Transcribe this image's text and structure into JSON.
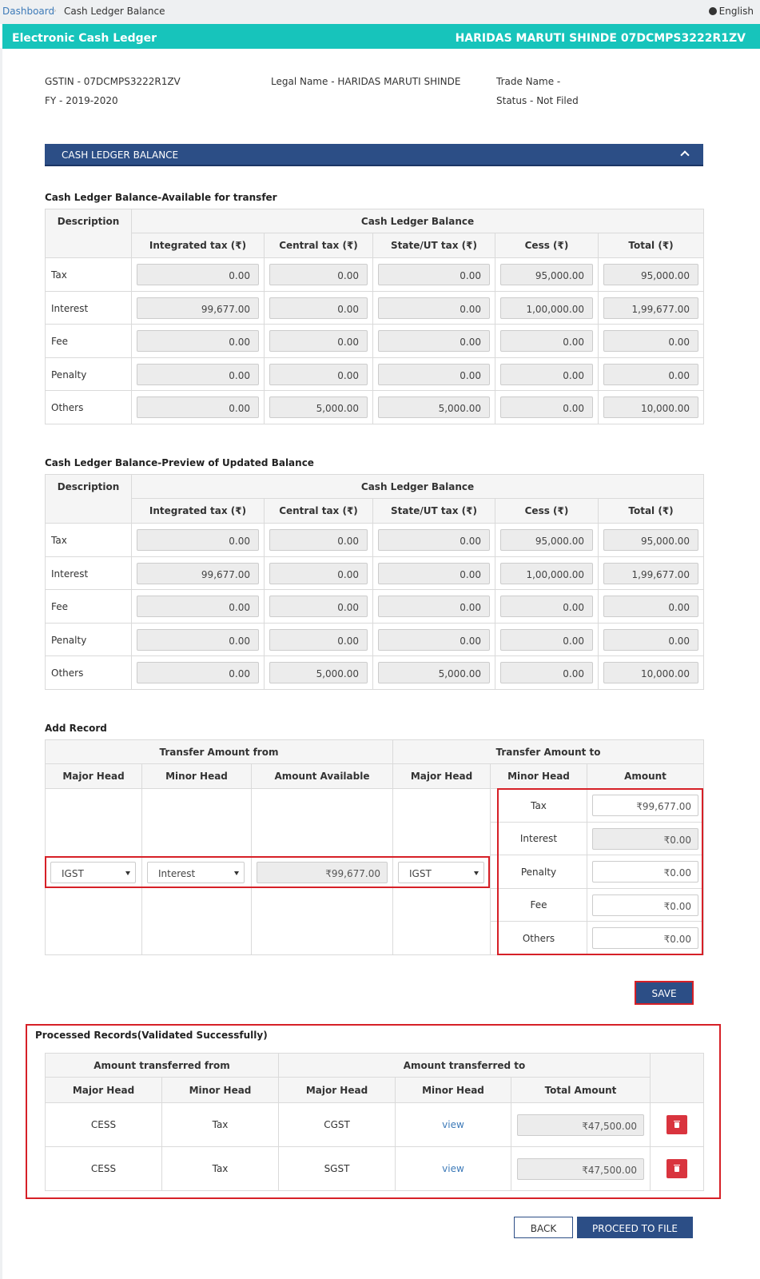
{
  "breadcrumb": {
    "home": "Dashboard",
    "separator": "›",
    "current": "Cash Ledger Balance"
  },
  "language": "English",
  "header": {
    "title": "Electronic Cash Ledger",
    "taxpayer": "HARIDAS MARUTI SHINDE 07DCMPS3222R1ZV"
  },
  "info": {
    "gstin": "GSTIN - 07DCMPS3222R1ZV",
    "fy": "FY - 2019-2020",
    "legal_name": "Legal Name - HARIDAS MARUTI SHINDE",
    "trade_name": "Trade Name -",
    "status": "Status - Not Filed"
  },
  "panel": {
    "title": "CASH LEDGER BALANCE"
  },
  "ledger_headers": {
    "description": "Description",
    "group": "Cash Ledger Balance",
    "columns": [
      "Integrated tax (₹)",
      "Central tax (₹)",
      "State/UT tax (₹)",
      "Cess (₹)",
      "Total (₹)"
    ]
  },
  "available": {
    "title": "Cash Ledger Balance-Available for transfer",
    "rows": [
      {
        "label": "Tax",
        "values": [
          "0.00",
          "0.00",
          "0.00",
          "95,000.00",
          "95,000.00"
        ]
      },
      {
        "label": "Interest",
        "values": [
          "99,677.00",
          "0.00",
          "0.00",
          "1,00,000.00",
          "1,99,677.00"
        ]
      },
      {
        "label": "Fee",
        "values": [
          "0.00",
          "0.00",
          "0.00",
          "0.00",
          "0.00"
        ]
      },
      {
        "label": "Penalty",
        "values": [
          "0.00",
          "0.00",
          "0.00",
          "0.00",
          "0.00"
        ]
      },
      {
        "label": "Others",
        "values": [
          "0.00",
          "5,000.00",
          "5,000.00",
          "0.00",
          "10,000.00"
        ]
      }
    ]
  },
  "preview": {
    "title": "Cash Ledger Balance-Preview of Updated Balance",
    "rows": [
      {
        "label": "Tax",
        "values": [
          "0.00",
          "0.00",
          "0.00",
          "95,000.00",
          "95,000.00"
        ]
      },
      {
        "label": "Interest",
        "values": [
          "99,677.00",
          "0.00",
          "0.00",
          "1,00,000.00",
          "1,99,677.00"
        ]
      },
      {
        "label": "Fee",
        "values": [
          "0.00",
          "0.00",
          "0.00",
          "0.00",
          "0.00"
        ]
      },
      {
        "label": "Penalty",
        "values": [
          "0.00",
          "0.00",
          "0.00",
          "0.00",
          "0.00"
        ]
      },
      {
        "label": "Others",
        "values": [
          "0.00",
          "5,000.00",
          "5,000.00",
          "0.00",
          "10,000.00"
        ]
      }
    ]
  },
  "add_record": {
    "title": "Add Record",
    "from_header": "Transfer Amount from",
    "to_header": "Transfer Amount to",
    "columns": [
      "Major Head",
      "Minor Head",
      "Amount Available",
      "Major Head",
      "Minor Head",
      "Amount"
    ],
    "from_major": "IGST",
    "from_minor": "Interest",
    "amount_available": "₹99,677.00",
    "to_major": "IGST",
    "to_rows": [
      {
        "label": "Tax",
        "value": "₹99,677.00"
      },
      {
        "label": "Interest",
        "value": "₹0.00"
      },
      {
        "label": "Penalty",
        "value": "₹0.00"
      },
      {
        "label": "Fee",
        "value": "₹0.00"
      },
      {
        "label": "Others",
        "value": "₹0.00"
      }
    ]
  },
  "save_label": "SAVE",
  "processed": {
    "title": "Processed Records(Validated Successfully)",
    "from_header": "Amount transferred from",
    "to_header": "Amount transferred to",
    "columns": [
      "Major Head",
      "Minor Head",
      "Major Head",
      "Minor Head",
      "Total Amount"
    ],
    "rows": [
      {
        "from_major": "CESS",
        "from_minor": "Tax",
        "to_major": "CGST",
        "to_minor": "view",
        "total": "₹47,500.00"
      },
      {
        "from_major": "CESS",
        "from_minor": "Tax",
        "to_major": "SGST",
        "to_minor": "view",
        "total": "₹47,500.00"
      }
    ]
  },
  "back_label": "BACK",
  "proceed_label": "PROCEED TO FILE"
}
